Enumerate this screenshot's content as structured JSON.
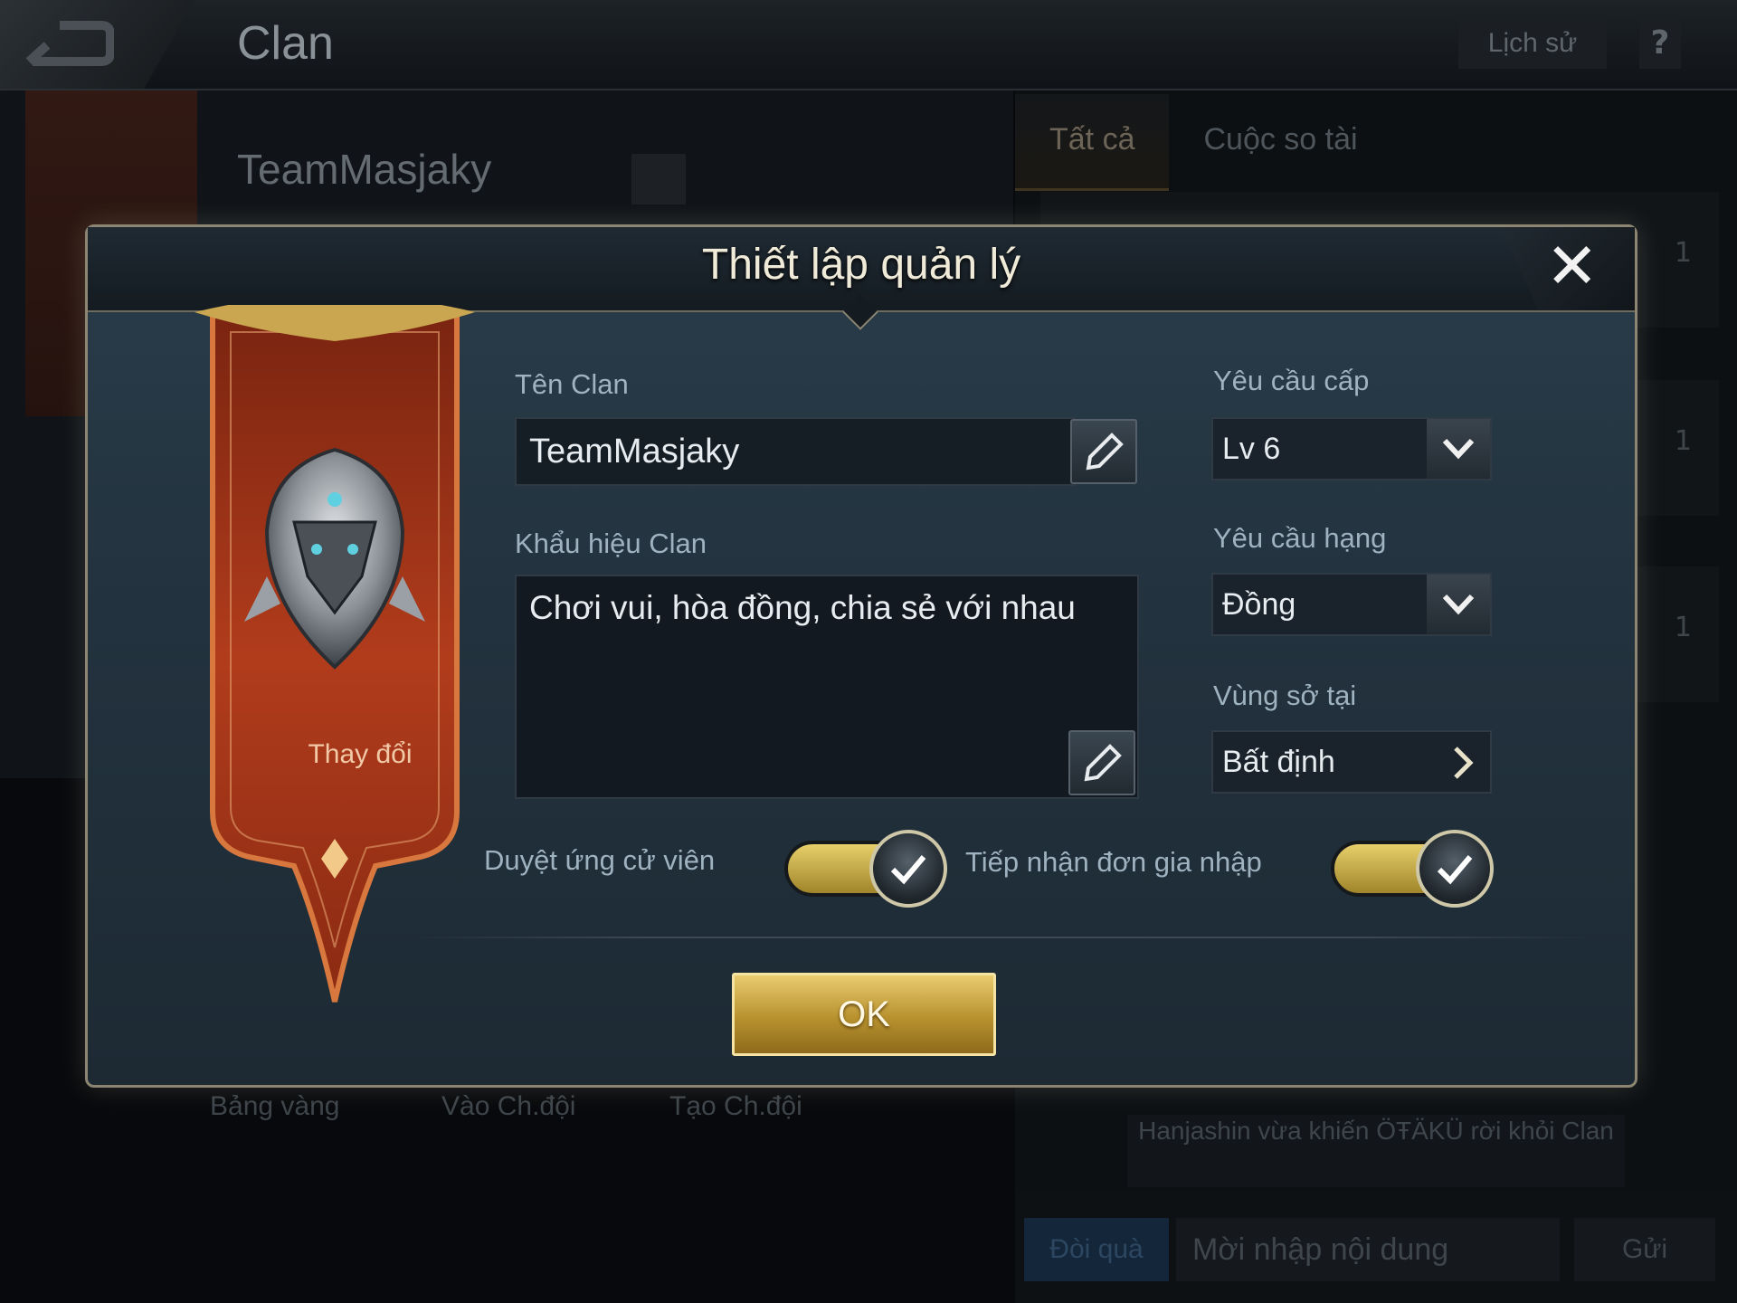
{
  "topbar": {
    "title": "Clan",
    "history_label": "Lịch sử",
    "help_label": "?"
  },
  "background": {
    "clan_name": "TeamMasjaky",
    "tabs": [
      "Tất cả",
      "Cuộc so tài"
    ],
    "bottom_links": [
      "Bảng vàng",
      "Vào Ch.đội",
      "Tạo Ch.đội"
    ],
    "feed_counts": [
      "1",
      "1",
      "1"
    ],
    "feed_message": "Hanjashin vừa khiến ÖŦÄKÜ rời khỏi Clan",
    "chat": {
      "gift_label": "Đòi quà",
      "input_placeholder": "Mời nhập nội dung",
      "send_label": "Gửi"
    }
  },
  "modal": {
    "title": "Thiết lập quản lý",
    "close_icon": "close-icon",
    "banner_change_label": "Thay đổi",
    "clan_name_label": "Tên Clan",
    "clan_name_value": "TeamMasjaky",
    "slogan_label": "Khẩu hiệu Clan",
    "slogan_value": "Chơi vui, hòa đồng, chia sẻ với nhau",
    "level_label": "Yêu cầu cấp",
    "level_value": "Lv 6",
    "rank_label": "Yêu cầu hạng",
    "rank_value": "Đồng",
    "region_label": "Vùng sở tại",
    "region_value": "Bất định",
    "approve_label": "Duyệt ứng cử viên",
    "approve_on": true,
    "accept_label": "Tiếp nhận đơn gia nhập",
    "accept_on": true,
    "ok_label": "OK"
  },
  "colors": {
    "accent_gold": "#d8b85a",
    "banner_red": "#b8401f",
    "panel_blue": "#23333f"
  }
}
